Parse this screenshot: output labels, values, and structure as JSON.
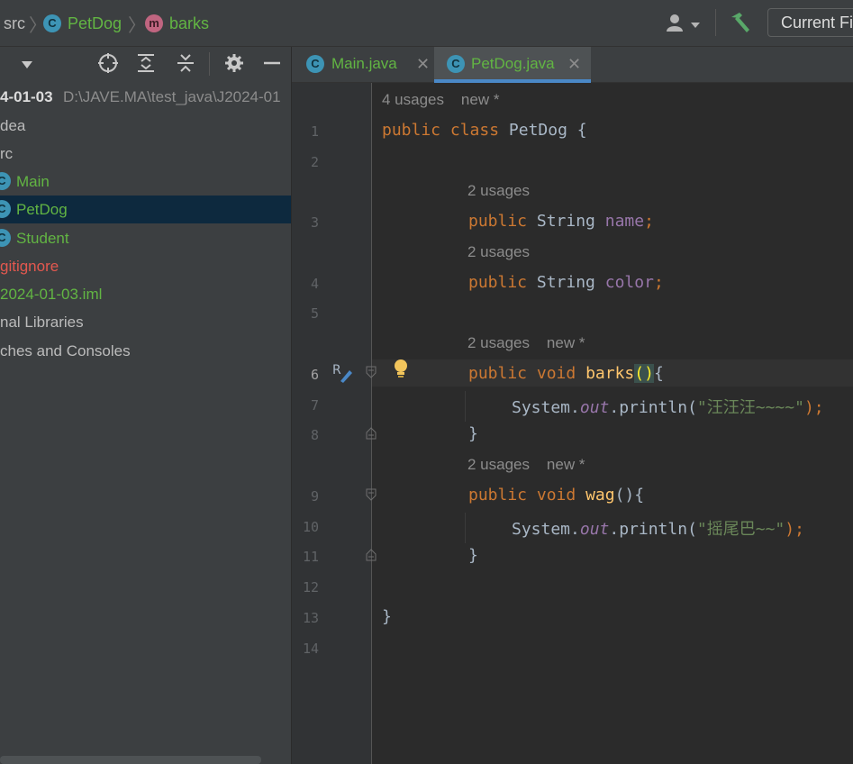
{
  "breadcrumb": {
    "items": [
      {
        "label": "src",
        "color": "#bbbbbb"
      },
      {
        "label": "PetDog",
        "color": "#62b543"
      },
      {
        "label": "barks",
        "color": "#62b543"
      }
    ]
  },
  "toolbar": {
    "run_config_label": "Current Fi"
  },
  "project_panel": {
    "tree": [
      {
        "label": "4-01-03",
        "suffix": "D:\\JAVE.MA\\test_java\\J2024-01",
        "color": "#dcdcdc"
      },
      {
        "label": "dea",
        "color": "#bbbbbb"
      },
      {
        "label": "rc",
        "color": "#bbbbbb"
      },
      {
        "label": "Main",
        "color": "#62b543",
        "icon": "class-run-icon"
      },
      {
        "label": "PetDog",
        "color": "#62b543",
        "icon": "class-icon",
        "selected": true
      },
      {
        "label": "Student",
        "color": "#62b543",
        "icon": "class-icon"
      },
      {
        "label": "gitignore",
        "color": "#e3584f"
      },
      {
        "label": "2024-01-03.iml",
        "color": "#62b543"
      },
      {
        "label": "nal Libraries",
        "color": "#bbbbbb"
      },
      {
        "label": "ches and Consoles",
        "color": "#bbbbbb"
      }
    ]
  },
  "tabs": [
    {
      "label": "Main.java",
      "color": "#62b543",
      "active": false
    },
    {
      "label": "PetDog.java",
      "color": "#62b543",
      "active": true
    }
  ],
  "editor": {
    "current_line": 6,
    "header_hint": {
      "usages": "4 usages",
      "author": "new *"
    },
    "line_numbers": [
      "1",
      "2",
      "3",
      "4",
      "5",
      "6",
      "7",
      "8",
      "9",
      "10",
      "11",
      "12",
      "13",
      "14"
    ],
    "hints": [
      {
        "usages": "2 usages",
        "author": ""
      },
      {
        "usages": "2 usages",
        "author": ""
      },
      {
        "usages": "2 usages",
        "author": "new *"
      },
      {
        "usages": "2 usages",
        "author": "new *"
      }
    ],
    "code": {
      "l1": [
        "public",
        "class",
        "PetDog",
        "{"
      ],
      "l3": [
        "public",
        "String",
        "name",
        ";"
      ],
      "l4": [
        "public",
        "String",
        "color",
        ";"
      ],
      "l6": [
        "public",
        "void",
        "barks",
        "()",
        "{"
      ],
      "l7": [
        "System.",
        "out",
        ".println(",
        "\"汪汪汪~~~~\"",
        ");"
      ],
      "l8": [
        "}"
      ],
      "l9": [
        "public",
        "void",
        "wag",
        "(){"
      ],
      "l10": [
        "System.",
        "out",
        ".println(",
        "\"摇尾巴~~\"",
        ");"
      ],
      "l11": [
        "}"
      ],
      "l13": [
        "}"
      ]
    }
  },
  "icons": [
    "user-icon",
    "chevron-down-icon",
    "hammer-icon",
    "chevron-down-icon",
    "locate-icon",
    "expand-all-icon",
    "collapse-all-icon",
    "gear-icon",
    "minimize-icon",
    "close-icon",
    "bulb-icon",
    "edit-icon",
    "fold-icon"
  ]
}
